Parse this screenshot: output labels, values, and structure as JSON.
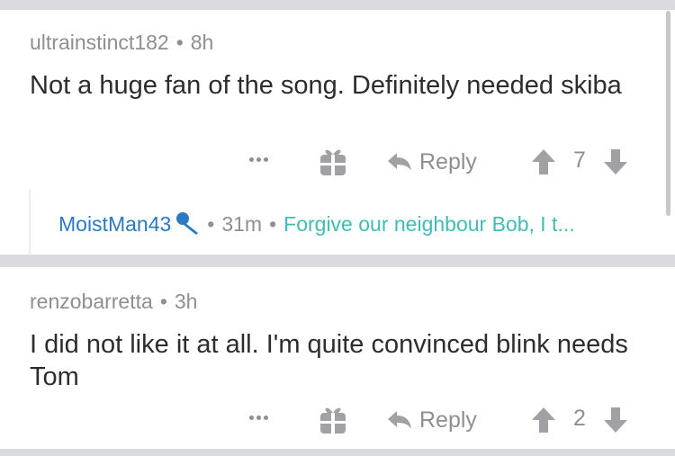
{
  "comments": [
    {
      "author": "ultrainstinct182",
      "separator": "•",
      "time": "8h",
      "body": "Not a huge fan of the song. Definitely needed skiba",
      "more_icon": "more-dots-icon",
      "gift_icon": "gift-icon",
      "reply_label": "Reply",
      "score": "7",
      "child": {
        "author": "MoistMan43",
        "flair_icon": "microphone-icon",
        "separator": "•",
        "time": "31m",
        "preview": "Forgive our neighbour Bob, I t..."
      }
    },
    {
      "author": "renzobarretta",
      "separator": "•",
      "time": "3h",
      "body": "I did not like it at all. I'm quite convinced blink needs Tom",
      "more_icon": "more-dots-icon",
      "gift_icon": "gift-icon",
      "reply_label": "Reply",
      "score": "2"
    }
  ],
  "colors": {
    "background": "#dadbe0",
    "card": "#ffffff",
    "meta_text": "#8e8e93",
    "body_text": "#2d2d2d",
    "author_link": "#2b79c2",
    "preview_link": "#3fbdb3",
    "mic_icon": "#2b79c2"
  }
}
